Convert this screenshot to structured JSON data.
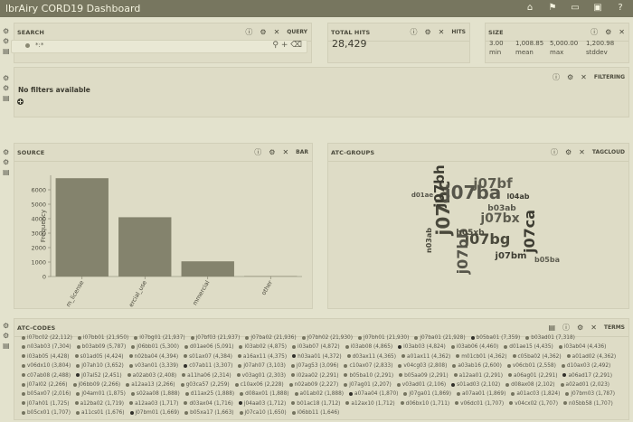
{
  "app": {
    "title": "lbrAiry CORD19 Dashboard"
  },
  "nav_icons": [
    "home-icon",
    "flag-icon",
    "folder-icon",
    "save-icon",
    "help-icon"
  ],
  "panels": {
    "search": {
      "title": "SEARCH",
      "tag": "QUERY",
      "query": "*:*"
    },
    "total_hits": {
      "title": "TOTAL HITS",
      "tag": "HITS",
      "value": "28,429"
    },
    "size": {
      "title": "SIZE",
      "values": [
        "3.00",
        "1,008.85",
        "5,000.00",
        "1,200.98"
      ],
      "labels": [
        "min",
        "mean",
        "max",
        "stddev"
      ]
    },
    "filters": {
      "tag": "FILTERING",
      "empty_text": "No filters available"
    },
    "source": {
      "title": "SOURCE",
      "tag": "BAR"
    },
    "atc_groups": {
      "title": "ATC-GROUPS",
      "tag": "TAGCLOUD"
    },
    "atc_codes": {
      "title": "ATC-CODES",
      "tag": "TERMS",
      "items": [
        "i07bc02 (22,112)",
        "i07bb01 (21,950)",
        "i07bg01 (21,937)",
        "j07bf03 (21,937)",
        "j07ba02 (21,936)",
        "j07bh02 (21,930)",
        "j07bh01 (21,930)",
        "j07ba01 (21,928)",
        "b05ba01 (7,359)",
        "b03ad01 (7,318)",
        "n03ab03 (7,304)",
        "b03ab09 (5,787)",
        "j06bb01 (5,300)",
        "d01ae06 (5,091)",
        "i03ab02 (4,875)",
        "i03ab07 (4,872)",
        "i03ab08 (4,865)",
        "i03ab03 (4,824)",
        "i03ab06 (4,460)",
        "d01ae15 (4,435)",
        "i03ab04 (4,436)",
        "i03ab05 (4,428)",
        "s01ad05 (4,424)",
        "n02ba04 (4,394)",
        "s01ax07 (4,384)",
        "a16ax11 (4,375)",
        "h03aa01 (4,372)",
        "d03ax11 (4,365)",
        "a01ax11 (4,362)",
        "m01cb01 (4,362)",
        "c05ba02 (4,362)",
        "a01ad02 (4,362)",
        "v06dx10 (3,804)",
        "j07ah10 (3,652)",
        "v03an01 (3,339)",
        "c07ab11 (3,307)",
        "j07ah07 (3,103)",
        "j07ag53 (3,096)",
        "c10ax07 (2,833)",
        "v04cg03 (2,808)",
        "a03ab16 (2,600)",
        "v06cb01 (2,558)",
        "d10ax03 (2,492)",
        "c07ab08 (2,488)",
        "j07al52 (2,451)",
        "a02ab03 (2,408)",
        "a11ha06 (2,314)",
        "v03ag01 (2,303)",
        "i02aa02 (2,291)",
        "b05ba10 (2,291)",
        "b05aa09 (2,291)",
        "a12aa01 (2,291)",
        "a06ag01 (2,291)",
        "a06ad17 (2,291)",
        "j07al02 (2,266)",
        "j06bb09 (2,266)",
        "a12aa13 (2,266)",
        "g03ca57 (2,259)",
        "c10ax06 (2,228)",
        "n02ab09 (2,227)",
        "j07ag01 (2,207)",
        "v03ad01 (2,106)",
        "s01ad03 (2,102)",
        "d08ax08 (2,102)",
        "a02ad01 (2,023)",
        "b05ax07 (2,016)",
        "j04am01 (1,875)",
        "s02aa08 (1,888)",
        "d11ax25 (1,888)",
        "d08ax01 (1,888)",
        "a01ab02 (1,888)",
        "a07aa04 (1,870)",
        "j07ga01 (1,869)",
        "a07aa01 (1,869)",
        "a01ac03 (1,824)",
        "j07bm03 (1,787)",
        "j07ah01 (1,725)",
        "a12ba02 (1,719)",
        "a12aa03 (1,717)",
        "d03ax04 (1,716)",
        "j04aa03 (1,712)",
        "b01ac18 (1,712)",
        "a12ax10 (1,712)",
        "d06bx10 (1,711)",
        "v06dc01 (1,707)",
        "v04cx02 (1,707)",
        "n05bb58 (1,707)",
        "b05cx01 (1,707)",
        "a11cs01 (1,676)",
        "j07bm01 (1,669)",
        "b05xa17 (1,663)",
        "j07ca10 (1,650)",
        "i06bb11 (1,646)"
      ]
    }
  },
  "chart_data": {
    "type": "bar",
    "categories": [
      "m_license",
      "ercial_use",
      "mmercial",
      "other"
    ],
    "values": [
      6800,
      4100,
      1050,
      30
    ],
    "xlabel": "",
    "ylabel": "Frequency",
    "ylim": [
      0,
      7000
    ],
    "yticks": [
      0,
      1000,
      2000,
      3000,
      4000,
      5000,
      6000
    ],
    "grid": false,
    "bar_color": "#84836d"
  },
  "tagcloud": [
    {
      "text": "j07bc"
    },
    {
      "text": "j07ba"
    },
    {
      "text": "j07bh"
    },
    {
      "text": "j07bf"
    },
    {
      "text": "j07bg"
    },
    {
      "text": "j07bb"
    },
    {
      "text": "j07ca"
    },
    {
      "text": "j07bx"
    },
    {
      "text": "b05xb"
    },
    {
      "text": "b03ab"
    },
    {
      "text": "l04ab"
    },
    {
      "text": "b05ba"
    },
    {
      "text": "n03ab"
    },
    {
      "text": "d01ae"
    },
    {
      "text": "j07bm"
    }
  ]
}
